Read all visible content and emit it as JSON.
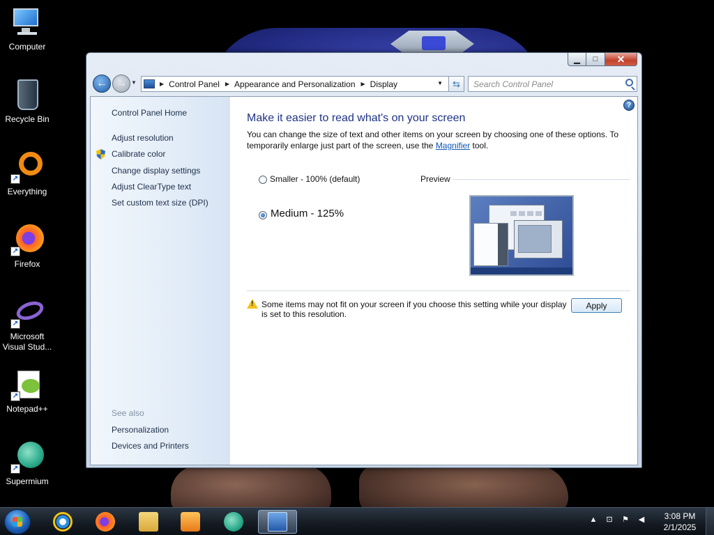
{
  "desktop": {
    "icons": [
      {
        "label": "Computer",
        "icon": "computer-icon"
      },
      {
        "label": "Recycle Bin",
        "icon": "recycle-bin-icon"
      },
      {
        "label": "Everything",
        "icon": "everything-icon"
      },
      {
        "label": "Firefox",
        "icon": "firefox-icon"
      },
      {
        "label": "Microsoft Visual Stud...",
        "icon": "visual-studio-icon"
      },
      {
        "label": "Notepad++",
        "icon": "notepadpp-icon"
      },
      {
        "label": "Supermium",
        "icon": "supermium-icon"
      }
    ]
  },
  "window": {
    "caption_buttons": {
      "minimize": "▁",
      "maximize": "□",
      "close": "✕"
    },
    "address": {
      "crumbs": [
        "Control Panel",
        "Appearance and Personalization",
        "Display"
      ]
    },
    "search_placeholder": "Search Control Panel"
  },
  "sidebar": {
    "home": "Control Panel Home",
    "links": [
      "Adjust resolution",
      "Calibrate color",
      "Change display settings",
      "Adjust ClearType text",
      "Set custom text size (DPI)"
    ],
    "see_also_label": "See also",
    "see_also": [
      "Personalization",
      "Devices and Printers"
    ]
  },
  "main": {
    "title": "Make it easier to read what's on your screen",
    "desc_before": "You can change the size of text and other items on your screen by choosing one of these options. To temporarily enlarge just part of the screen, use the ",
    "desc_link": "Magnifier",
    "desc_after": " tool.",
    "options": [
      {
        "label": "Smaller - 100% (default)",
        "selected": false
      },
      {
        "label": "Medium - 125%",
        "selected": true
      }
    ],
    "preview_label": "Preview",
    "warning": "Some items may not fit on your screen if you choose this setting while your display is set to this resolution.",
    "apply_label": "Apply",
    "help": "?"
  },
  "taskbar": {
    "apps": [
      "start-orb",
      "internet-explorer-icon",
      "firefox-icon",
      "file-explorer-icon",
      "media-player-icon",
      "supermium-icon",
      "display-control-panel-icon"
    ],
    "time": "3:08 PM",
    "date": "2/1/2025"
  },
  "colors": {
    "accent": "#1e3287",
    "link": "#0b55b8",
    "taskbar": "#141a22"
  }
}
